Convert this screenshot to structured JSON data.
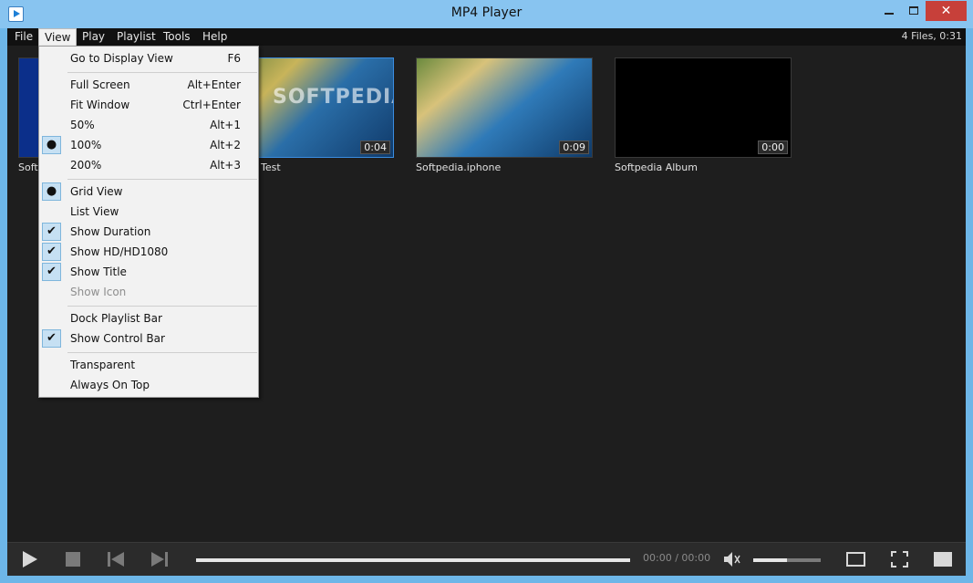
{
  "window": {
    "title": "MP4 Player",
    "close_glyph": "✕"
  },
  "menubar": {
    "items": [
      "File",
      "View",
      "Play",
      "Playlist",
      "Tools",
      "Help"
    ],
    "info": "4 Files, 0:31"
  },
  "thumbnails": [
    {
      "title": "Softpedia",
      "duration": ""
    },
    {
      "title": "Test",
      "duration": "0:04"
    },
    {
      "title": "Softpedia.iphone",
      "duration": "0:09"
    },
    {
      "title": "Softpedia Album",
      "duration": "0:00"
    }
  ],
  "view_menu": {
    "items": [
      {
        "label": "Go to Display View",
        "shortcut": "F6",
        "mark": ""
      },
      {
        "label": "Full Screen",
        "shortcut": "Alt+Enter",
        "mark": ""
      },
      {
        "label": "Fit Window",
        "shortcut": "Ctrl+Enter",
        "mark": ""
      },
      {
        "label": "50%",
        "shortcut": "Alt+1",
        "mark": ""
      },
      {
        "label": "100%",
        "shortcut": "Alt+2",
        "mark": "●"
      },
      {
        "label": "200%",
        "shortcut": "Alt+3",
        "mark": ""
      },
      {
        "label": "Grid View",
        "shortcut": "",
        "mark": "●"
      },
      {
        "label": "List View",
        "shortcut": "",
        "mark": ""
      },
      {
        "label": "Show Duration",
        "shortcut": "",
        "mark": "✔"
      },
      {
        "label": "Show HD/HD1080",
        "shortcut": "",
        "mark": "✔"
      },
      {
        "label": "Show Title",
        "shortcut": "",
        "mark": "✔"
      },
      {
        "label": "Show Icon",
        "shortcut": "",
        "mark": ""
      },
      {
        "label": "Dock Playlist Bar",
        "shortcut": "",
        "mark": ""
      },
      {
        "label": "Show Control Bar",
        "shortcut": "",
        "mark": "✔"
      },
      {
        "label": "Transparent",
        "shortcut": "",
        "mark": ""
      },
      {
        "label": "Always On Top",
        "shortcut": "",
        "mark": ""
      }
    ]
  },
  "controls": {
    "time": "00:00 / 00:00",
    "volume_fraction": 0.5,
    "progress_fraction": 0
  },
  "watermark": "SOFTPEDIA",
  "colors": {
    "accent": "#3b8de0",
    "titlebar": "#88c4f0",
    "close": "#c7403a"
  }
}
